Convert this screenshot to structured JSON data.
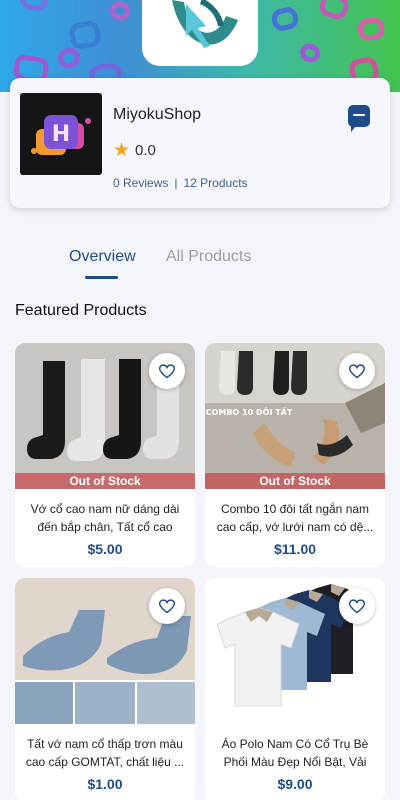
{
  "shop": {
    "name": "MiyokuShop",
    "rating": "0.0",
    "reviews": "0 Reviews",
    "separator": "|",
    "products": "12 Products"
  },
  "tabs": [
    {
      "label": "Overview",
      "active": true
    },
    {
      "label": "All Products",
      "active": false
    }
  ],
  "section_title": "Featured Products",
  "products": [
    {
      "name": "Vớ cổ cao nam nữ dáng dài đến bắp chân, Tất cổ cao na...",
      "price": "$5.00",
      "status": "Out of Stock"
    },
    {
      "name": "Combo 10 đôi tất ngắn nam cao cấp, vớ lưới nam có dệ...",
      "price": "$11.00",
      "status": "Out of Stock",
      "image_caption": "COMBO 10 ĐÔI TẤT"
    },
    {
      "name": "Tất vớ nam cổ thấp trơn màu cao cấp GOMTAT, chất liệu ...",
      "price": "$1.00",
      "status": ""
    },
    {
      "name": "Áo Polo Nam Có Cổ Trụ Bè Phối Màu Đẹp Nổi Bật, Vải C...",
      "price": "$9.00",
      "status": ""
    }
  ],
  "colors": {
    "accent": "#1f4d8c",
    "out_of_stock": "#c84646",
    "star": "#f0a22a"
  },
  "icons": [
    "chat-icon",
    "star-icon",
    "heart-icon"
  ]
}
